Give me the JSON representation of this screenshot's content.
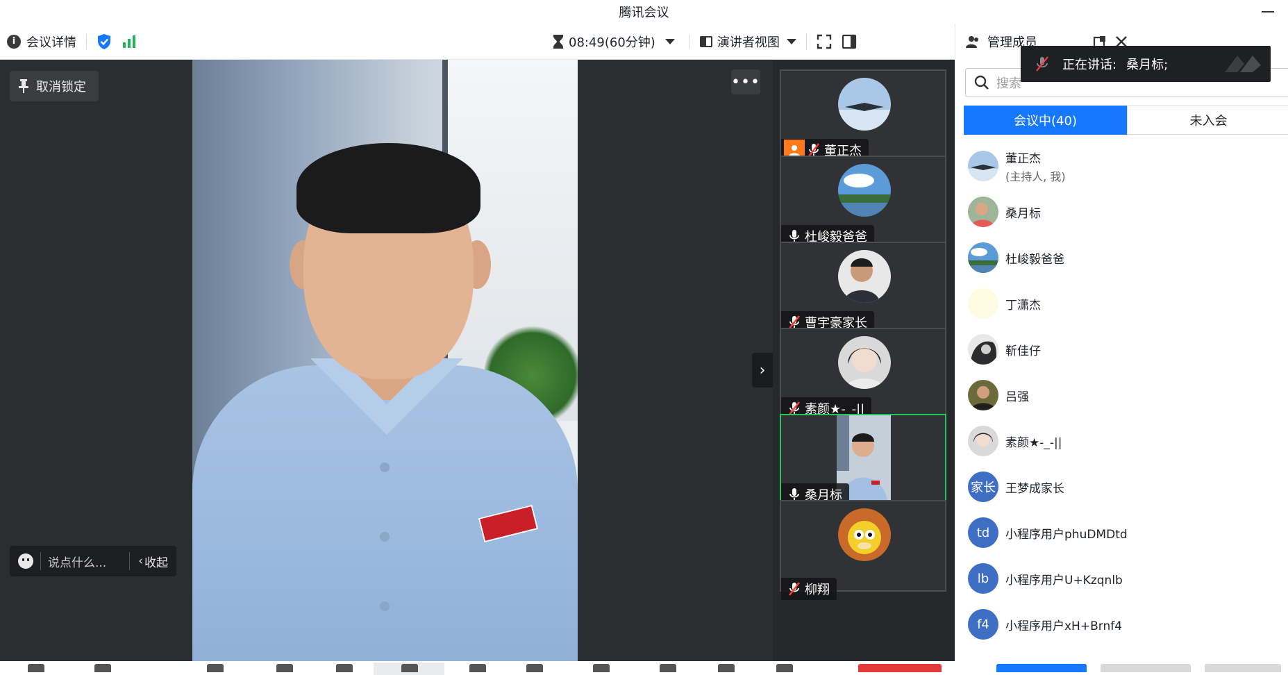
{
  "window": {
    "title": "腾讯会议"
  },
  "toolbar": {
    "meeting_details": "会议详情",
    "timer": "08:49(60分钟)",
    "view_mode": "演讲者视图"
  },
  "stage": {
    "unlock_label": "取消锁定",
    "chat_placeholder": "说点什么...",
    "collapse_label": "收起"
  },
  "thumbnails": [
    {
      "name": "董正杰",
      "host": true,
      "mic": "muted"
    },
    {
      "name": "杜峻毅爸爸",
      "host": false,
      "mic": "on"
    },
    {
      "name": "曹宇豪家长",
      "host": false,
      "mic": "muted"
    },
    {
      "name": "素颜★-_-||",
      "host": false,
      "mic": "muted"
    },
    {
      "name": "桑月标",
      "host": false,
      "mic": "on",
      "active": true
    },
    {
      "name": "柳翔",
      "host": false,
      "mic": "muted"
    }
  ],
  "panel": {
    "title": "管理成员",
    "search_placeholder": "搜索",
    "speaking_label": "正在讲话:",
    "speaking_name": "桑月标;",
    "tab_in_meeting": "会议中(40)",
    "tab_not_joined": "未入会"
  },
  "members": [
    {
      "name": "董正杰",
      "sub": "(主持人, 我)",
      "avatar": "photo"
    },
    {
      "name": "桑月标",
      "sub": "",
      "avatar": "photo"
    },
    {
      "name": "杜峻毅爸爸",
      "sub": "",
      "avatar": "photo"
    },
    {
      "name": "丁潇杰",
      "sub": "",
      "avatar": "blank"
    },
    {
      "name": "靳佳仔",
      "sub": "",
      "avatar": "photo"
    },
    {
      "name": "吕强",
      "sub": "",
      "avatar": "photo"
    },
    {
      "name": "素颜★-_-||",
      "sub": "",
      "avatar": "photo"
    },
    {
      "name": "王梦成家长",
      "sub": "",
      "avatar": "text",
      "avatar_text": "家长"
    },
    {
      "name": "小程序用户phuDMDtd",
      "sub": "",
      "avatar": "text",
      "avatar_text": "td"
    },
    {
      "name": "小程序用户U+Kzqnlb",
      "sub": "",
      "avatar": "text",
      "avatar_text": "lb"
    },
    {
      "name": "小程序用户xH+Brnf4",
      "sub": "",
      "avatar": "text",
      "avatar_text": "f4"
    }
  ],
  "colors": {
    "accent": "#1677ff",
    "active_border": "#22c55e",
    "host_badge": "#ff7a1a",
    "stage_bg": "#2b2d30",
    "avatar_text_bg": "#3e6fc4"
  }
}
